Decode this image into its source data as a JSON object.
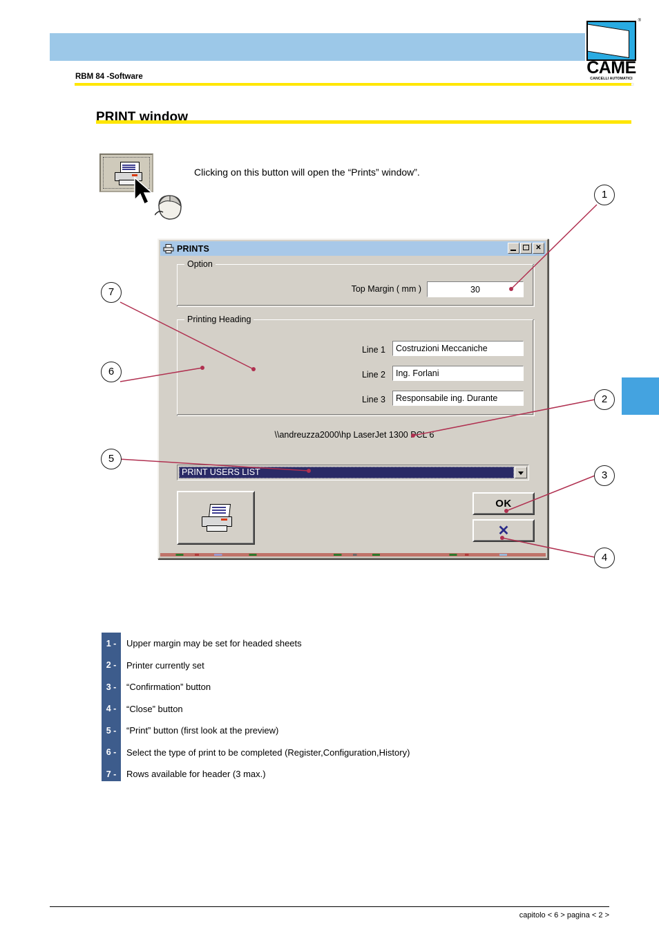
{
  "header": {
    "doc_subtitle": "RBM 84 -Software",
    "page_title": "PRINT window",
    "logo": {
      "word": "CAME",
      "subtitle": "CANCELLI AUTOMATICI",
      "subtitle_shadow": "CANCELLI AUTOMATICI",
      "registered_mark": "®"
    },
    "banner_color": "#9cc8e8",
    "rule_color": "#ffe600"
  },
  "intro": {
    "text": "Clicking on this button will open the “Prints” window”.",
    "button_icon": "printer-icon",
    "cursor_icon": "mouse-pointer-icon",
    "mouse_icon": "computer-mouse-icon"
  },
  "dialog": {
    "title": "PRINTS",
    "title_icon": "printer-icon",
    "window_buttons": {
      "minimize": "_",
      "maximize": "□",
      "close": "✕"
    },
    "option_group": {
      "legend": "Option",
      "margin_label": "Top Margin ( mm )",
      "margin_value": "30"
    },
    "heading_group": {
      "legend": "Printing Heading",
      "rows": [
        {
          "label": "Line 1",
          "value": "Costruzioni Meccaniche"
        },
        {
          "label": "Line 2",
          "value": "Ing. Forlani"
        },
        {
          "label": "Line 3",
          "value": "Responsabile ing. Durante"
        }
      ]
    },
    "printer_name": "\\\\andreuzza2000\\hp LaserJet 1300 PCL 6",
    "print_type_combo": {
      "selected": "PRINT USERS LIST",
      "arrow_icon": "chevron-down-icon"
    },
    "buttons": {
      "print": {
        "label": "",
        "icon": "printer-icon"
      },
      "ok": {
        "label": "OK",
        "icon": ""
      },
      "close": {
        "label": "✕",
        "icon": "x-icon"
      }
    }
  },
  "callouts": [
    {
      "n": "1"
    },
    {
      "n": "2"
    },
    {
      "n": "3"
    },
    {
      "n": "4"
    },
    {
      "n": "5"
    },
    {
      "n": "6"
    },
    {
      "n": "7"
    }
  ],
  "legend": {
    "band_color": "#3d5c8c",
    "items": [
      {
        "num": "1 -",
        "text": "Upper margin may be set for headed sheets"
      },
      {
        "num": "2 -",
        "text": "Printer currently set"
      },
      {
        "num": "3 -",
        "text": "“Confirmation” button"
      },
      {
        "num": "4 -",
        "text": "“Close” button"
      },
      {
        "num": "5 -",
        "text": "“Print” button (first look at the preview)"
      },
      {
        "num": "6 -",
        "text": "Select the type of print to be completed (Register,Configuration,History)"
      },
      {
        "num": "7 -",
        "text": "Rows available for header (3 max.)"
      }
    ]
  },
  "footer": {
    "text": "capitolo < 6 > pagina < 2 >"
  },
  "side_tab": {
    "color": "#44a3e0"
  }
}
